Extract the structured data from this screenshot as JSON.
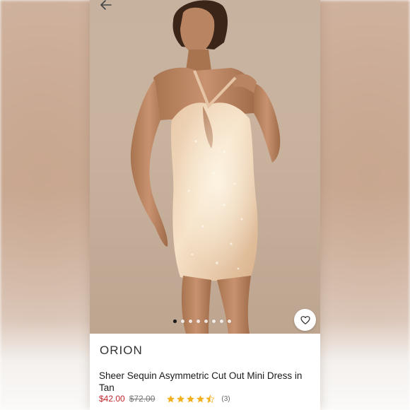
{
  "product": {
    "brand": "ORION",
    "title": "Sheer Sequin Asymmetric Cut Out Mini Dress in Tan",
    "sale_price": "$42.00",
    "original_price": "$72.00",
    "rating": 4.5,
    "review_count": "(3)"
  },
  "gallery": {
    "image_count": 8,
    "active_index": 0,
    "image_subject": "model wearing tan sequin mini dress"
  },
  "icons": {
    "back": "back-arrow-icon",
    "wishlist": "heart-icon",
    "rating": "star-icon"
  },
  "colors": {
    "sale_price": "#c0272d",
    "star": "#f2b01e",
    "active_dot": "#1a1a1a"
  }
}
